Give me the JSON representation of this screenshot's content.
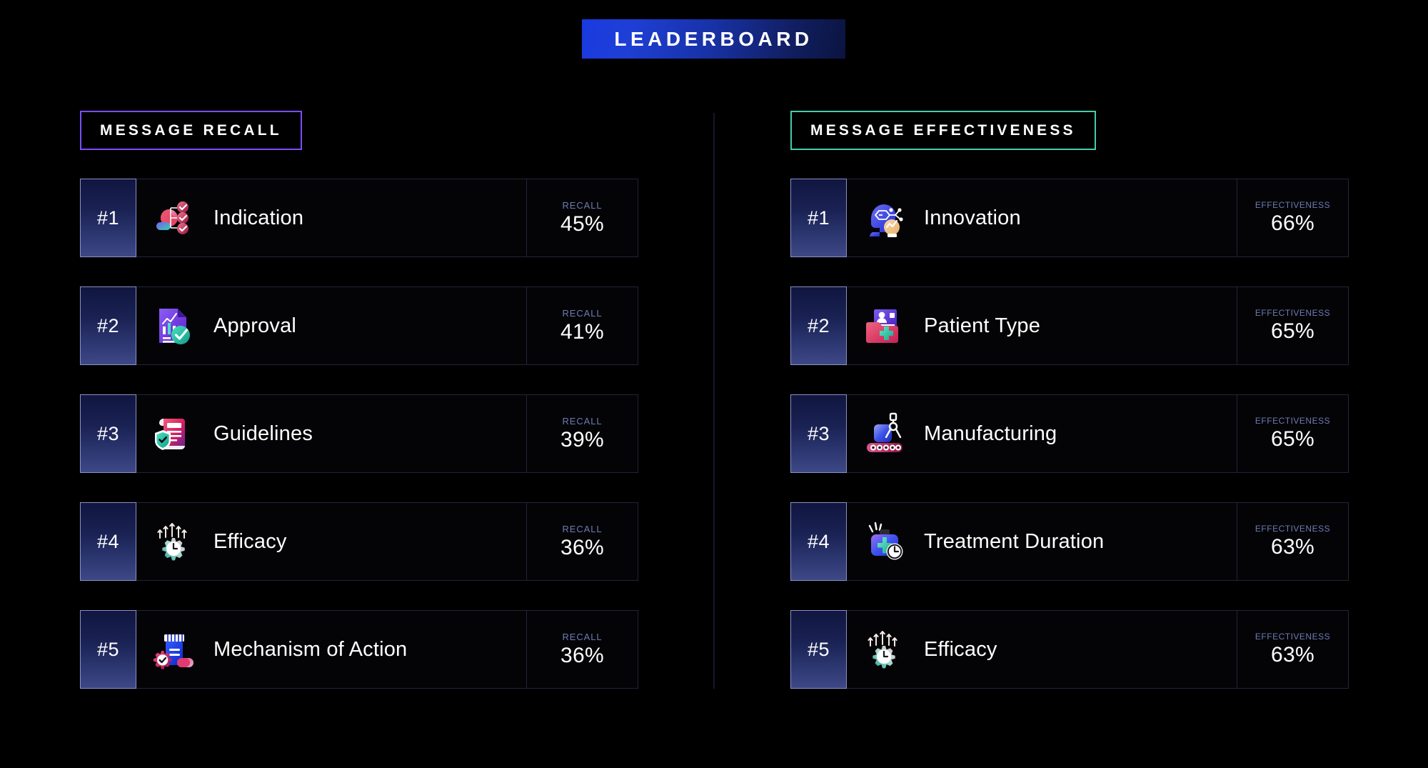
{
  "header": {
    "title": "LEADERBOARD"
  },
  "columns": [
    {
      "id": "message-recall",
      "heading": "MESSAGE RECALL",
      "accent": "#7c4dff",
      "metric_label": "RECALL",
      "rows": [
        {
          "rank": "#1",
          "label": "Indication",
          "value": "45%",
          "icon": "indication-icon"
        },
        {
          "rank": "#2",
          "label": "Approval",
          "value": "41%",
          "icon": "approval-icon"
        },
        {
          "rank": "#3",
          "label": "Guidelines",
          "value": "39%",
          "icon": "guidelines-icon"
        },
        {
          "rank": "#4",
          "label": "Efficacy",
          "value": "36%",
          "icon": "efficacy-icon"
        },
        {
          "rank": "#5",
          "label": "Mechanism of Action",
          "value": "36%",
          "icon": "mechanism-of-action-icon"
        }
      ]
    },
    {
      "id": "message-effectiveness",
      "heading": "MESSAGE EFFECTIVENESS",
      "accent": "#45ccaa",
      "metric_label": "EFFECTIVENESS",
      "rows": [
        {
          "rank": "#1",
          "label": "Innovation",
          "value": "66%",
          "icon": "innovation-icon"
        },
        {
          "rank": "#2",
          "label": "Patient Type",
          "value": "65%",
          "icon": "patient-type-icon"
        },
        {
          "rank": "#3",
          "label": "Manufacturing",
          "value": "65%",
          "icon": "manufacturing-icon"
        },
        {
          "rank": "#4",
          "label": "Treatment Duration",
          "value": "63%",
          "icon": "treatment-duration-icon"
        },
        {
          "rank": "#5",
          "label": "Efficacy",
          "value": "63%",
          "icon": "efficacy-icon"
        }
      ]
    }
  ],
  "chart_data": {
    "type": "bar",
    "title": "LEADERBOARD",
    "series": [
      {
        "name": "Message Recall",
        "unit": "%",
        "categories": [
          "Indication",
          "Approval",
          "Guidelines",
          "Efficacy",
          "Mechanism of Action"
        ],
        "values": [
          45,
          41,
          39,
          36,
          36
        ]
      },
      {
        "name": "Message Effectiveness",
        "unit": "%",
        "categories": [
          "Innovation",
          "Patient Type",
          "Manufacturing",
          "Treatment Duration",
          "Efficacy"
        ],
        "values": [
          66,
          65,
          65,
          63,
          63
        ]
      }
    ]
  }
}
